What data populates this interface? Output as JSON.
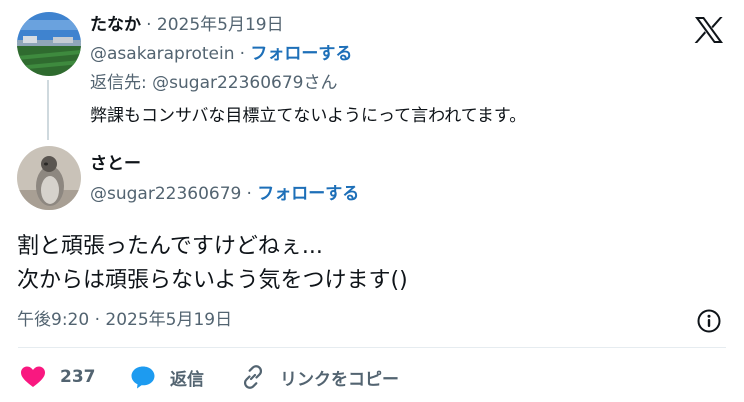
{
  "reply": {
    "display_name": "たなか",
    "date": "2025年5月19日",
    "handle": "@asakaraprotein",
    "follow_label": "フォローする",
    "reply_to_prefix": "返信先: ",
    "reply_to_handle": "@sugar22360679",
    "reply_to_suffix": "さん",
    "body": "弊課もコンサバな目標立てないようにって言われてます。"
  },
  "main": {
    "display_name": "さとー",
    "handle": "@sugar22360679",
    "follow_label": "フォローする",
    "body_line1": "割と頑張ったんですけどねぇ...",
    "body_line2": "次からは頑張らないよう気をつけます()",
    "timestamp": "午後9:20 · 2025年5月19日"
  },
  "actions": {
    "like_count": "237",
    "reply_label": "返信",
    "copy_link_label": "リンクをコピー"
  },
  "colors": {
    "like": "#f91880",
    "reply": "#1d9bf0",
    "muted": "#536471",
    "follow": "#1d6fb8"
  }
}
